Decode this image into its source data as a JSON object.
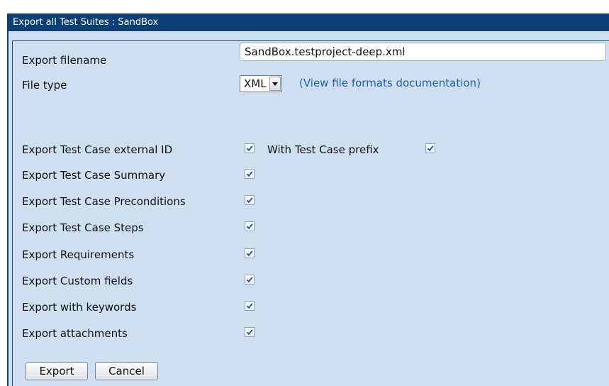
{
  "window": {
    "title": "Export all Test Suites : SandBox"
  },
  "form": {
    "filename_label": "Export filename",
    "filename_value": "SandBox.testproject-deep.xml",
    "filetype_label": "File type",
    "filetype_selected": "XML",
    "doc_link": "(View file formats documentation)",
    "options": [
      {
        "label": "Export Test Case external ID",
        "checked": true
      },
      {
        "label": "Export Test Case Summary",
        "checked": true
      },
      {
        "label": "Export Test Case Preconditions",
        "checked": true
      },
      {
        "label": "Export Test Case Steps",
        "checked": true
      },
      {
        "label": "Export Requirements",
        "checked": true
      },
      {
        "label": "Export Custom fields",
        "checked": true
      },
      {
        "label": "Export with keywords",
        "checked": true
      },
      {
        "label": "Export attachments",
        "checked": true
      }
    ],
    "prefix_label": "With Test Case prefix",
    "prefix_checked": true
  },
  "buttons": {
    "export_label": "Export",
    "cancel_label": "Cancel"
  },
  "icons": {
    "checkbox_mark": "checkmark-icon",
    "dropdown": "chevron-down-icon"
  },
  "colors": {
    "titlebar": "#0c3f73",
    "background": "#cfdff0",
    "link": "#1f5faa"
  }
}
